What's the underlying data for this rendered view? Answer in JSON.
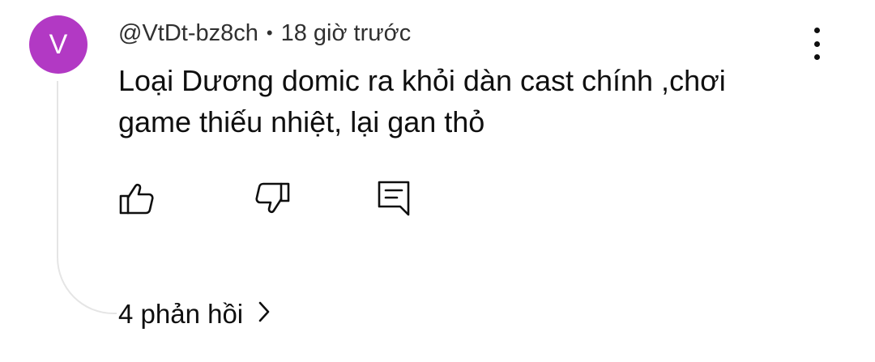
{
  "comment": {
    "avatar_letter": "V",
    "avatar_color": "#b239c4",
    "author": "@VtDt-bz8ch",
    "separator": "•",
    "timestamp": "18 giờ trước",
    "text": "Loại Dương domic ra khỏi dàn cast chính ,chơi game thiếu nhiệt, lại gan thỏ",
    "actions": {
      "like_icon": "thumb-up-icon",
      "dislike_icon": "thumb-down-icon",
      "reply_icon": "reply-comment-icon"
    },
    "replies_label": "4 phản hồi",
    "more_icon": "more-vertical-icon"
  }
}
